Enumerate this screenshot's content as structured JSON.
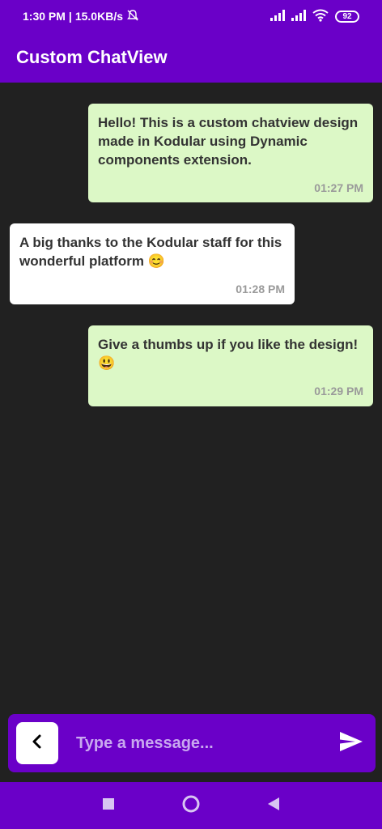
{
  "status_bar": {
    "time": "1:30 PM",
    "separator": "|",
    "network_speed": "15.0KB/s",
    "battery_level": "92",
    "icons": [
      "alarm-off-icon",
      "signal-icon",
      "signal-icon-2",
      "wifi-icon",
      "battery-icon"
    ]
  },
  "app_bar": {
    "title": "Custom ChatView",
    "color": "#6a00c8"
  },
  "messages": [
    {
      "direction": "sent",
      "text": "Hello! This is a custom chatview design made in Kodular using Dynamic components extension.",
      "time": "01:27 PM"
    },
    {
      "direction": "received",
      "text": "A big thanks to the Kodular staff for this wonderful platform 😊",
      "time": "01:28 PM"
    },
    {
      "direction": "sent",
      "text": "Give a thumbs up if you like the design! 😃",
      "time": "01:29 PM"
    }
  ],
  "input_bar": {
    "placeholder": "Type a message...",
    "value": "",
    "back_icon": "chevron-left-icon",
    "send_icon": "send-icon"
  },
  "nav_bar": {
    "icons": [
      "square-icon",
      "circle-icon",
      "triangle-back-icon"
    ]
  },
  "colors": {
    "primary": "#6a00c8",
    "background": "#212121",
    "sent_bubble": "#dcf8c6",
    "received_bubble": "#ffffff"
  }
}
